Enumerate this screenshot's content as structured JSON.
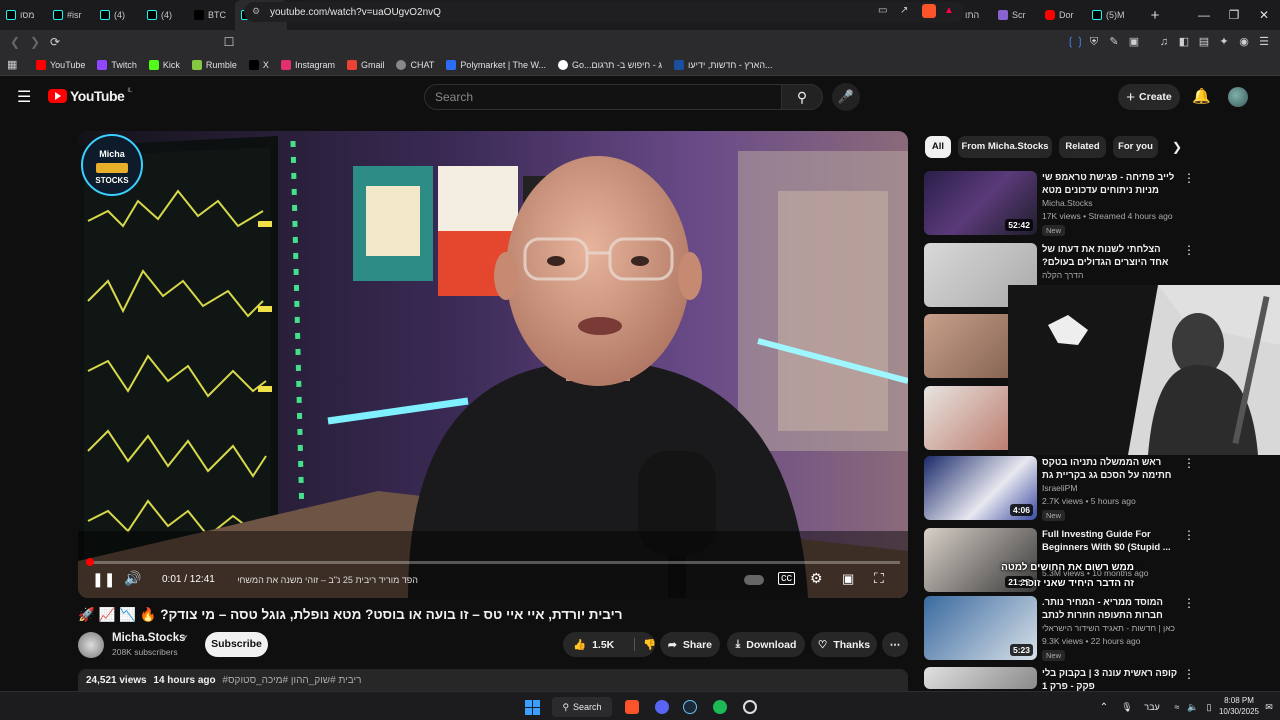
{
  "browser": {
    "tabs": [
      {
        "label": "מסו",
        "icon": "tiktok"
      },
      {
        "label": "#isr",
        "icon": "tiktok"
      },
      {
        "label": "(4)",
        "icon": "tiktok"
      },
      {
        "label": "(4)",
        "icon": "tiktok"
      },
      {
        "label": "BTC",
        "icon": "tradingview"
      },
      {
        "label": "ר",
        "icon": "audio"
      },
      {
        "label": "(4)",
        "icon": "tiktok"
      },
      {
        "label": "Cap",
        "icon": "tiktok"
      },
      {
        "label": "Holy",
        "icon": "youtube"
      },
      {
        "label": "I Fo",
        "icon": "youtube"
      },
      {
        "label": "נמ",
        "icon": "youtube"
      },
      {
        "label": "(4)",
        "icon": "tiktok"
      },
      {
        "label": "Heb",
        "icon": "x"
      },
      {
        "label": "Wh",
        "icon": "youtube"
      },
      {
        "label": "(4)",
        "icon": "tiktok"
      },
      {
        "label": "(4)",
        "icon": "tiktok"
      },
      {
        "label": "פרו",
        "icon": "youtube"
      },
      {
        "label": "אמי",
        "icon": "google"
      },
      {
        "label": "Scr",
        "icon": "purple"
      },
      {
        "label": "(4)U",
        "icon": "tiktok"
      },
      {
        "label": "התו",
        "icon": "youtube"
      },
      {
        "label": "Scr",
        "icon": "purple"
      },
      {
        "label": "Dor",
        "icon": "youtube"
      },
      {
        "label": "(5)M",
        "icon": "tiktok"
      }
    ],
    "url": "youtube.com/watch?v=uaOUgvO2nvQ",
    "bookmarks": [
      {
        "label": "YouTube",
        "icon": "youtube"
      },
      {
        "label": "Twitch",
        "icon": "twitch"
      },
      {
        "label": "Kick",
        "icon": "kick"
      },
      {
        "label": "Rumble",
        "icon": "rumble"
      },
      {
        "label": "X",
        "icon": "x"
      },
      {
        "label": "Instagram",
        "icon": "instagram"
      },
      {
        "label": "Gmail",
        "icon": "gmail"
      },
      {
        "label": "CHAT",
        "icon": "chat"
      },
      {
        "label": "Polymarket | The W...",
        "icon": "polymarket"
      },
      {
        "label": "Go...ג - חיפוש ב- תרגום",
        "icon": "google"
      },
      {
        "label": "הארץ - חדשות, ידיעו...",
        "icon": "haaretz"
      }
    ]
  },
  "youtube": {
    "logo_text": "YouTube",
    "region": "IL",
    "search_placeholder": "Search",
    "create_label": "Create"
  },
  "player": {
    "channel_watermark": "Micha STOCKS",
    "poster_text_1": "WORK HARD",
    "poster_text_2": "PLAY HARD",
    "time": "0:01 / 12:41",
    "chapter": "הפד מוריד ריבית 25 נ\"ב – זוהי משנה את המשחק"
  },
  "video": {
    "title": "ריבית יורדת, איי איי טס – זו בועה או בוסט? מטא נופלת, גוגל טסה – מי צודק? 🔥 📉 📈 🚀",
    "channel": "Micha.Stocks",
    "subscribers": "208K subscribers",
    "subscribe_label": "Subscribe",
    "likes": "1.5K",
    "share_label": "Share",
    "download_label": "Download",
    "thanks_label": "Thanks",
    "views": "24,521 views",
    "age": "14 hours ago",
    "hashtags": "#ריבית #שוק_ההון #מיכה_סטוקס"
  },
  "sidebar": {
    "chips": [
      "All",
      "From Micha.Stocks",
      "Related",
      "For you"
    ],
    "videos": [
      {
        "title": "לייב פתיחה - פגישת טראמפ שי מניות ניתוחים עדכונים מטא מיקרוסופט",
        "channel": "Micha.Stocks",
        "meta": "17K views • Streamed 4 hours ago",
        "badge": "New",
        "duration": "52:42",
        "rtl": true
      },
      {
        "title": "הצלחתי לשנות את דעתו של אחד היוצרים הגדולים בעולם?",
        "channel": "הדרך הקלה",
        "meta": "",
        "badge": "",
        "duration": "",
        "rtl": true
      },
      {
        "title": "",
        "channel": "",
        "meta": "",
        "badge": "",
        "duration": "",
        "rtl": true
      },
      {
        "title": "",
        "channel": "",
        "meta": "",
        "badge": "",
        "duration": "",
        "rtl": true
      },
      {
        "title": "ראש הממשלה נתניהו בטקס חתימה על הסכם גג בקריית גת",
        "channel": "IsraeliPM",
        "meta": "2.7K views • 5 hours ago",
        "badge": "New",
        "duration": "4:06",
        "rtl": true
      },
      {
        "title": "Full Investing Guide For Beginners With $0 (Stupid ...",
        "channel": "",
        "meta": "5.3M views • 10 months ago",
        "badge": "",
        "duration": "21:25",
        "rtl": false
      },
      {
        "title": "המוסד ממריא - המחיר נותר. חברות התעופה חוזרות לנתב לעיגים",
        "channel": "כאן | חדשות - תאגיד השידור הישראלי",
        "meta": "9.3K views • 22 hours ago",
        "badge": "New",
        "duration": "5:23",
        "rtl": true
      },
      {
        "title": "קופה ראשית עונה 3 | בקבוק בלי פקק - פרק 1",
        "channel": "",
        "meta": "",
        "badge": "",
        "duration": "",
        "rtl": true
      }
    ],
    "overlay_caption_1": "ממש רשום את החושים למטה",
    "overlay_caption_2": "זה הדבר היחיד שאני זוכר:"
  },
  "taskbar": {
    "search_label": "Search",
    "lang": "עבר",
    "time": "8:08 PM",
    "date": "10/30/2025"
  }
}
